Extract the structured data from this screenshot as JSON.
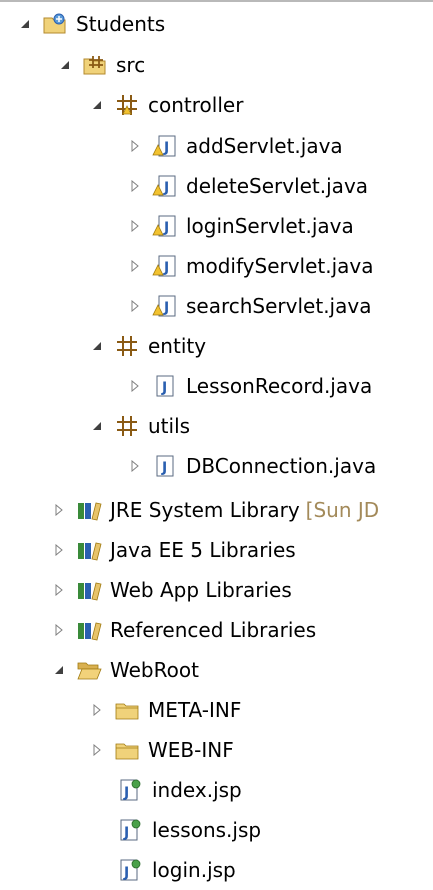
{
  "tree": {
    "project": {
      "label": "Students",
      "icon": "java-project-icon",
      "expanded": true
    },
    "src": {
      "label": "src",
      "icon": "source-folder-icon",
      "expanded": true
    },
    "packages": [
      {
        "label": "controller",
        "icon": "package-icon",
        "expanded": true,
        "files": [
          {
            "label": "addServlet.java",
            "icon": "java-file-warning-icon"
          },
          {
            "label": "deleteServlet.java",
            "icon": "java-file-warning-icon"
          },
          {
            "label": "loginServlet.java",
            "icon": "java-file-warning-icon"
          },
          {
            "label": "modifyServlet.java",
            "icon": "java-file-warning-icon"
          },
          {
            "label": "searchServlet.java",
            "icon": "java-file-warning-icon"
          }
        ]
      },
      {
        "label": "entity",
        "icon": "package-icon",
        "expanded": true,
        "files": [
          {
            "label": "LessonRecord.java",
            "icon": "java-file-icon"
          }
        ]
      },
      {
        "label": "utils",
        "icon": "package-icon",
        "expanded": true,
        "files": [
          {
            "label": "DBConnection.java",
            "icon": "java-file-icon"
          }
        ]
      }
    ],
    "libraries": [
      {
        "label": "JRE System Library",
        "decoration": "[Sun JD",
        "icon": "library-icon"
      },
      {
        "label": "Java EE 5 Libraries",
        "icon": "library-icon"
      },
      {
        "label": "Web App Libraries",
        "icon": "library-icon"
      },
      {
        "label": "Referenced Libraries",
        "icon": "library-icon"
      }
    ],
    "webroot": {
      "label": "WebRoot",
      "icon": "folder-open-icon",
      "expanded": true,
      "folders": [
        {
          "label": "META-INF",
          "icon": "folder-icon"
        },
        {
          "label": "WEB-INF",
          "icon": "folder-icon"
        }
      ],
      "files": [
        {
          "label": "index.jsp",
          "icon": "jsp-file-icon"
        },
        {
          "label": "lessons.jsp",
          "icon": "jsp-file-icon"
        },
        {
          "label": "login.jsp",
          "icon": "jsp-file-icon"
        }
      ]
    }
  },
  "colors": {
    "decoration": "#a38a5a",
    "package_brown": "#8a5a14",
    "library_green": "#3a8a3a",
    "folder_yellow": "#e8c46a",
    "java_blue": "#2a5fb0",
    "warning_yellow": "#f2c230"
  }
}
